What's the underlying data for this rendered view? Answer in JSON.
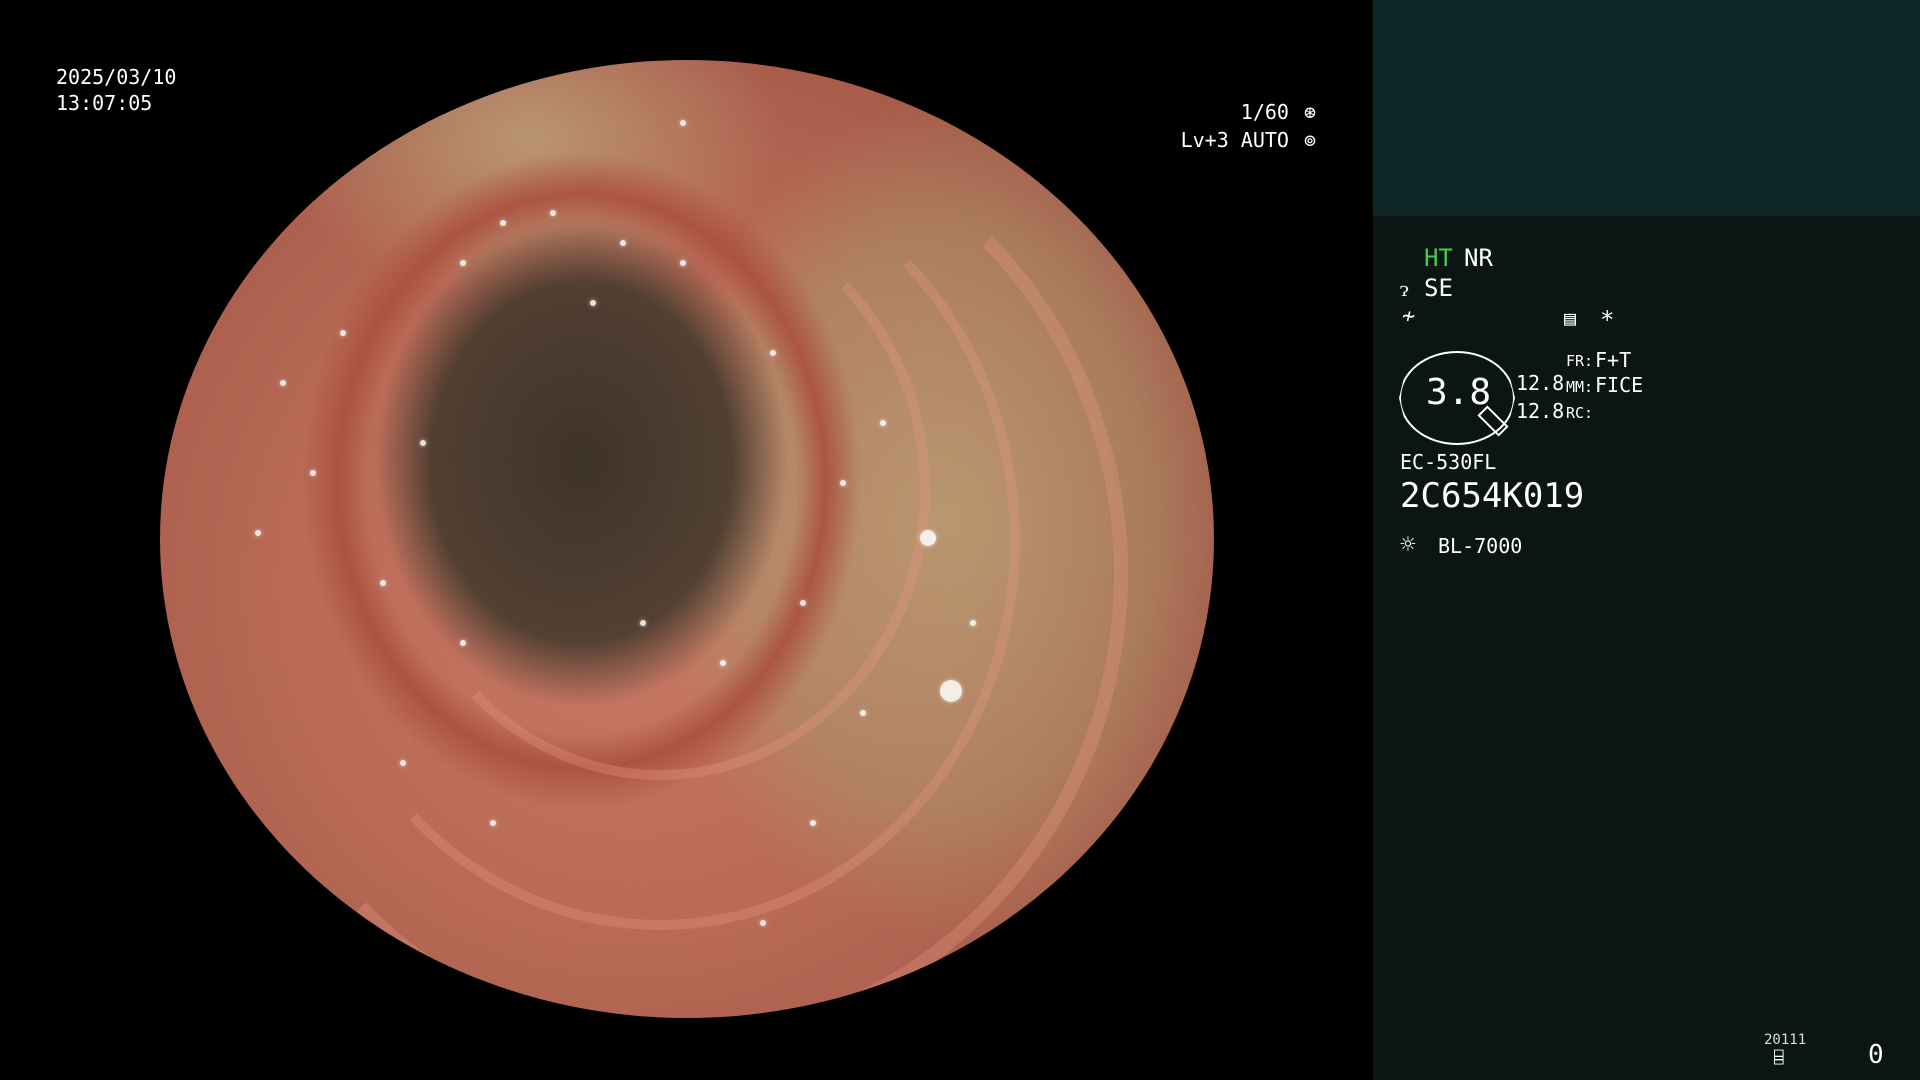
{
  "overlay": {
    "date": "2025/03/10",
    "time": "13:07:05",
    "shutter": "1/60",
    "shutter_icon": "aperture-icon",
    "level": "Lv+3 AUTO",
    "auto_icon": "iris-icon"
  },
  "panel": {
    "ht_label": "HT",
    "nr_label": "NR",
    "se_label": "SE",
    "se_icon": "scope-bend-icon",
    "freeze_icon": "freeze-icon",
    "menu_icon": "menu-icon",
    "asterisk": "*",
    "lens_value": "3.8",
    "zoom_line1": "12.8",
    "zoom_line2": "12.8",
    "fr_label": "FR:",
    "fr_value": "F+T",
    "mm_label": "MM:",
    "mm_value": "FICE",
    "rc_label": "RC:",
    "scope_model": "EC-530FL",
    "serial": "2C654K019",
    "light_icon": "light-source-icon",
    "light_source": "BL-7000",
    "storage_count": "20111",
    "storage_icon": "storage-icon",
    "counter": "0"
  }
}
